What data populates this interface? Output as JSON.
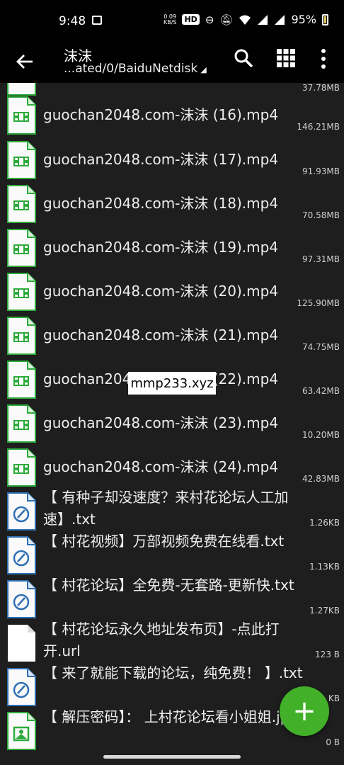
{
  "status_bar": {
    "time": "9:48",
    "speed": "0.09\nKB/S",
    "hd": "HD",
    "battery_pct": "95%"
  },
  "app_bar": {
    "title": "沫沫",
    "path": "...ated/0/BaiduNetdisk",
    "back_icon": "arrow-left",
    "search_icon": "search",
    "grid_icon": "grid",
    "more_icon": "more-vertical"
  },
  "files": [
    {
      "name": "",
      "size": "37.78MB",
      "type": "video"
    },
    {
      "name": "guochan2048.com-沫沫 (16).mp4",
      "size": "146.21MB",
      "type": "video"
    },
    {
      "name": "guochan2048.com-沫沫 (17).mp4",
      "size": "91.93MB",
      "type": "video"
    },
    {
      "name": "guochan2048.com-沫沫 (18).mp4",
      "size": "70.58MB",
      "type": "video"
    },
    {
      "name": "guochan2048.com-沫沫 (19).mp4",
      "size": "97.31MB",
      "type": "video"
    },
    {
      "name": "guochan2048.com-沫沫 (20).mp4",
      "size": "125.90MB",
      "type": "video"
    },
    {
      "name": "guochan2048.com-沫沫 (21).mp4",
      "size": "74.75MB",
      "type": "video"
    },
    {
      "name": "guochan2048.com-沫沫 (22).mp4",
      "size": "63.42MB",
      "type": "video"
    },
    {
      "name": "guochan2048.com-沫沫 (23).mp4",
      "size": "10.20MB",
      "type": "video"
    },
    {
      "name": "guochan2048.com-沫沫 (24).mp4",
      "size": "42.83MB",
      "type": "video"
    },
    {
      "name": "【 有种子却没速度？来村花论坛人工加速】.txt",
      "size": "1.26KB",
      "type": "text"
    },
    {
      "name": "【 村花视频】万部视频免费在线看.txt",
      "size": "1.13KB",
      "type": "text"
    },
    {
      "name": "【 村花论坛】全免费-无套路-更新快.txt",
      "size": "1.27KB",
      "type": "text"
    },
    {
      "name": "【 村花论坛永久地址发布页】-点此打开.url",
      "size": "123 B",
      "type": "blank"
    },
    {
      "name": "【 来了就能下载的论坛，纯免费！ 】.txt",
      "size": "KB",
      "type": "text"
    },
    {
      "name": "【 解压密码】： 上村花论坛看小姐姐.jpg",
      "size": "0 B",
      "type": "image"
    }
  ],
  "watermark": "mmp233.xyz",
  "fab": {
    "label": "+",
    "icon": "add-icon"
  },
  "colors": {
    "accent_green": "#43b02a",
    "video_icon": "#2eaa3c",
    "text_icon": "#2f6fb3"
  }
}
